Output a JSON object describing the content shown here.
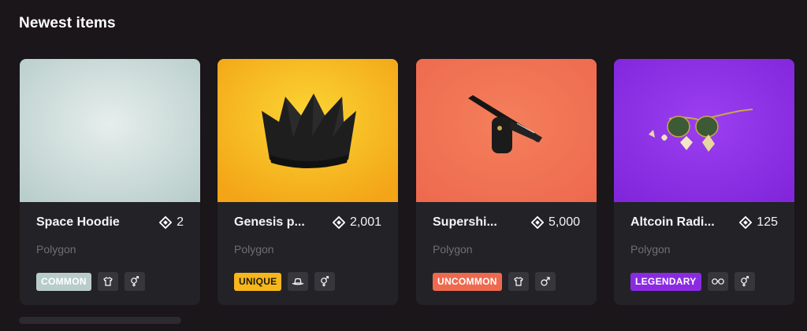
{
  "section": {
    "title": "Newest items"
  },
  "items": [
    {
      "name": "Space Hoodie",
      "price": "2",
      "network": "Polygon",
      "rarity": "COMMON",
      "rarity_color": "#b8cccb",
      "rarity_text_color": "#ffffff",
      "thumb_bg": "#c3d6d4",
      "category_icon": "upper-body-icon",
      "gender_icon": "unisex-icon"
    },
    {
      "name": "Genesis p...",
      "price": "2,001",
      "network": "Polygon",
      "rarity": "UNIQUE",
      "rarity_color": "#f7b71b",
      "rarity_text_color": "#1e1a10",
      "thumb_bg": "#f5b61c",
      "category_icon": "hat-icon",
      "gender_icon": "unisex-icon"
    },
    {
      "name": "Supershi...",
      "price": "5,000",
      "network": "Polygon",
      "rarity": "UNCOMMON",
      "rarity_color": "#ee6a4f",
      "rarity_text_color": "#ffffff",
      "thumb_bg": "#f0704f",
      "category_icon": "upper-body-icon",
      "gender_icon": "male-icon"
    },
    {
      "name": "Altcoin Radi...",
      "price": "125",
      "network": "Polygon",
      "rarity": "LEGENDARY",
      "rarity_color": "#8a2be2",
      "rarity_text_color": "#ffffff",
      "thumb_bg": "#8b32e0",
      "category_icon": "eyewear-icon",
      "gender_icon": "unisex-icon"
    }
  ],
  "price_icon": "mana-diamond-icon"
}
